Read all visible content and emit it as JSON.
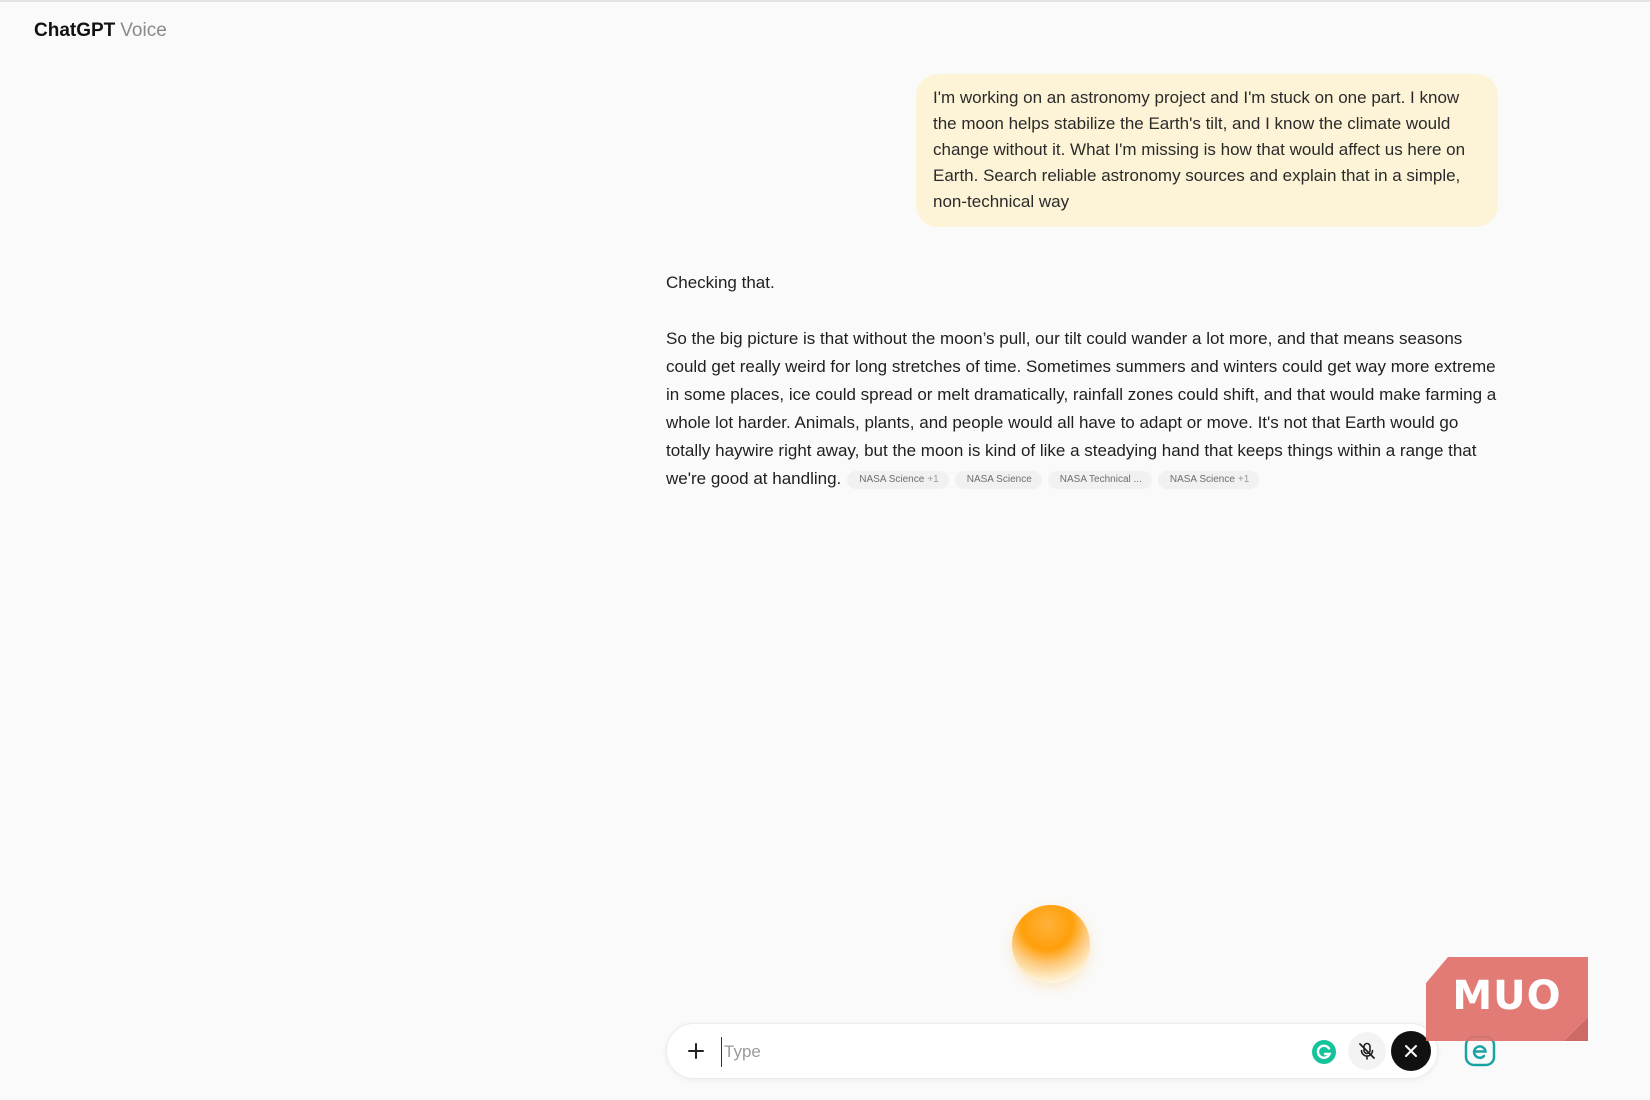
{
  "header": {
    "app_name": "ChatGPT",
    "mode": "Voice"
  },
  "conversation": {
    "user_message": "I'm working on an astronomy project and I'm stuck on one part. I know the moon helps stabilize the Earth's tilt, and I know the climate would change without it. What I'm missing is how that would affect us here on Earth. Search reliable astronomy sources and explain that in a simple, non-technical way",
    "assistant_intro": "Checking that.",
    "assistant_answer": "So the big picture is that without the moon’s pull, our tilt could wander a lot more, and that means seasons could get really weird for long stretches of time. Sometimes summers and winters could get way more extreme in some places, ice could spread or melt dramatically, rainfall zones could shift, and that would make farming a whole lot harder. Animals, plants, and people would all have to adapt or move. It's not that Earth would go totally haywire right away, but the moon is kind of like a steadying hand that keeps things within a range that we're good at handling.",
    "citations": [
      {
        "label": "NASA Science",
        "count": "+1"
      },
      {
        "label": "NASA Science",
        "count": ""
      },
      {
        "label": "NASA Technical ...",
        "count": ""
      },
      {
        "label": "NASA Science",
        "count": "+1"
      }
    ]
  },
  "composer": {
    "placeholder": "Type",
    "value": ""
  },
  "watermark": {
    "text": "MUO"
  },
  "icons": {
    "plus": "plus-icon",
    "grammarly": "grammarly-icon",
    "mic_muted": "mic-off-icon",
    "end_voice": "close-icon",
    "extension": "extension-e-icon"
  },
  "colors": {
    "user_bubble": "#fdf4d7",
    "orb": "#ff9f0a",
    "end_button": "#111111",
    "grammarly": "#15c39a",
    "extension": "#1aa3a3",
    "watermark": "#e0716c"
  }
}
